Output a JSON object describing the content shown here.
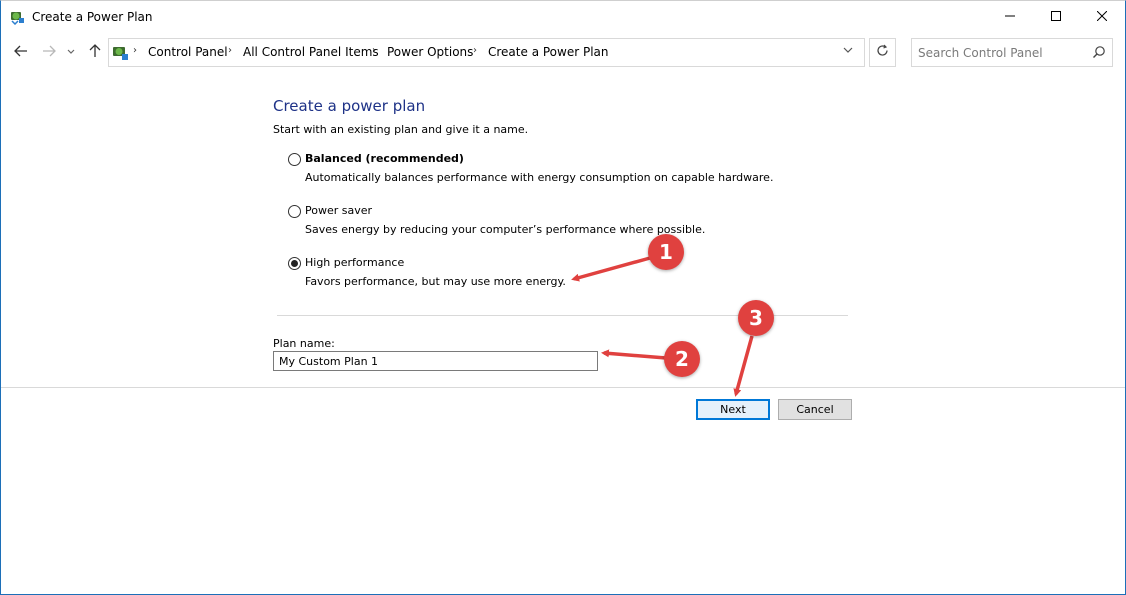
{
  "window": {
    "title": "Create a Power Plan",
    "accent_color": "#1c6fb8"
  },
  "titlebar_buttons": {
    "minimize_icon": "minimize-icon",
    "maximize_icon": "maximize-icon",
    "close_icon": "close-icon"
  },
  "navigation": {
    "back_icon": "back-arrow-icon",
    "forward_icon": "forward-arrow-icon",
    "recent_icon": "chevron-down-icon",
    "up_icon": "up-arrow-icon",
    "breadcrumb": [
      "Control Panel",
      "All Control Panel Items",
      "Power Options",
      "Create a Power Plan"
    ],
    "refresh_icon": "refresh-icon",
    "search_placeholder": "Search Control Panel"
  },
  "content": {
    "heading": "Create a power plan",
    "heading_color": "#1e3287",
    "intro": "Start with an existing plan and give it a name.",
    "options": [
      {
        "label": "Balanced (recommended)",
        "description": "Automatically balances performance with energy consumption on capable hardware.",
        "selected": false
      },
      {
        "label": "Power saver",
        "description": "Saves energy by reducing your computer’s performance where possible.",
        "selected": false
      },
      {
        "label": "High performance",
        "description": "Favors performance, but may use more energy.",
        "selected": true
      }
    ],
    "plan_name_label": "Plan name:",
    "plan_name_value": "My Custom Plan 1"
  },
  "buttons": {
    "next": "Next",
    "cancel": "Cancel"
  },
  "annotations": {
    "color": "#e0413f",
    "badges": [
      "1",
      "2",
      "3"
    ]
  }
}
